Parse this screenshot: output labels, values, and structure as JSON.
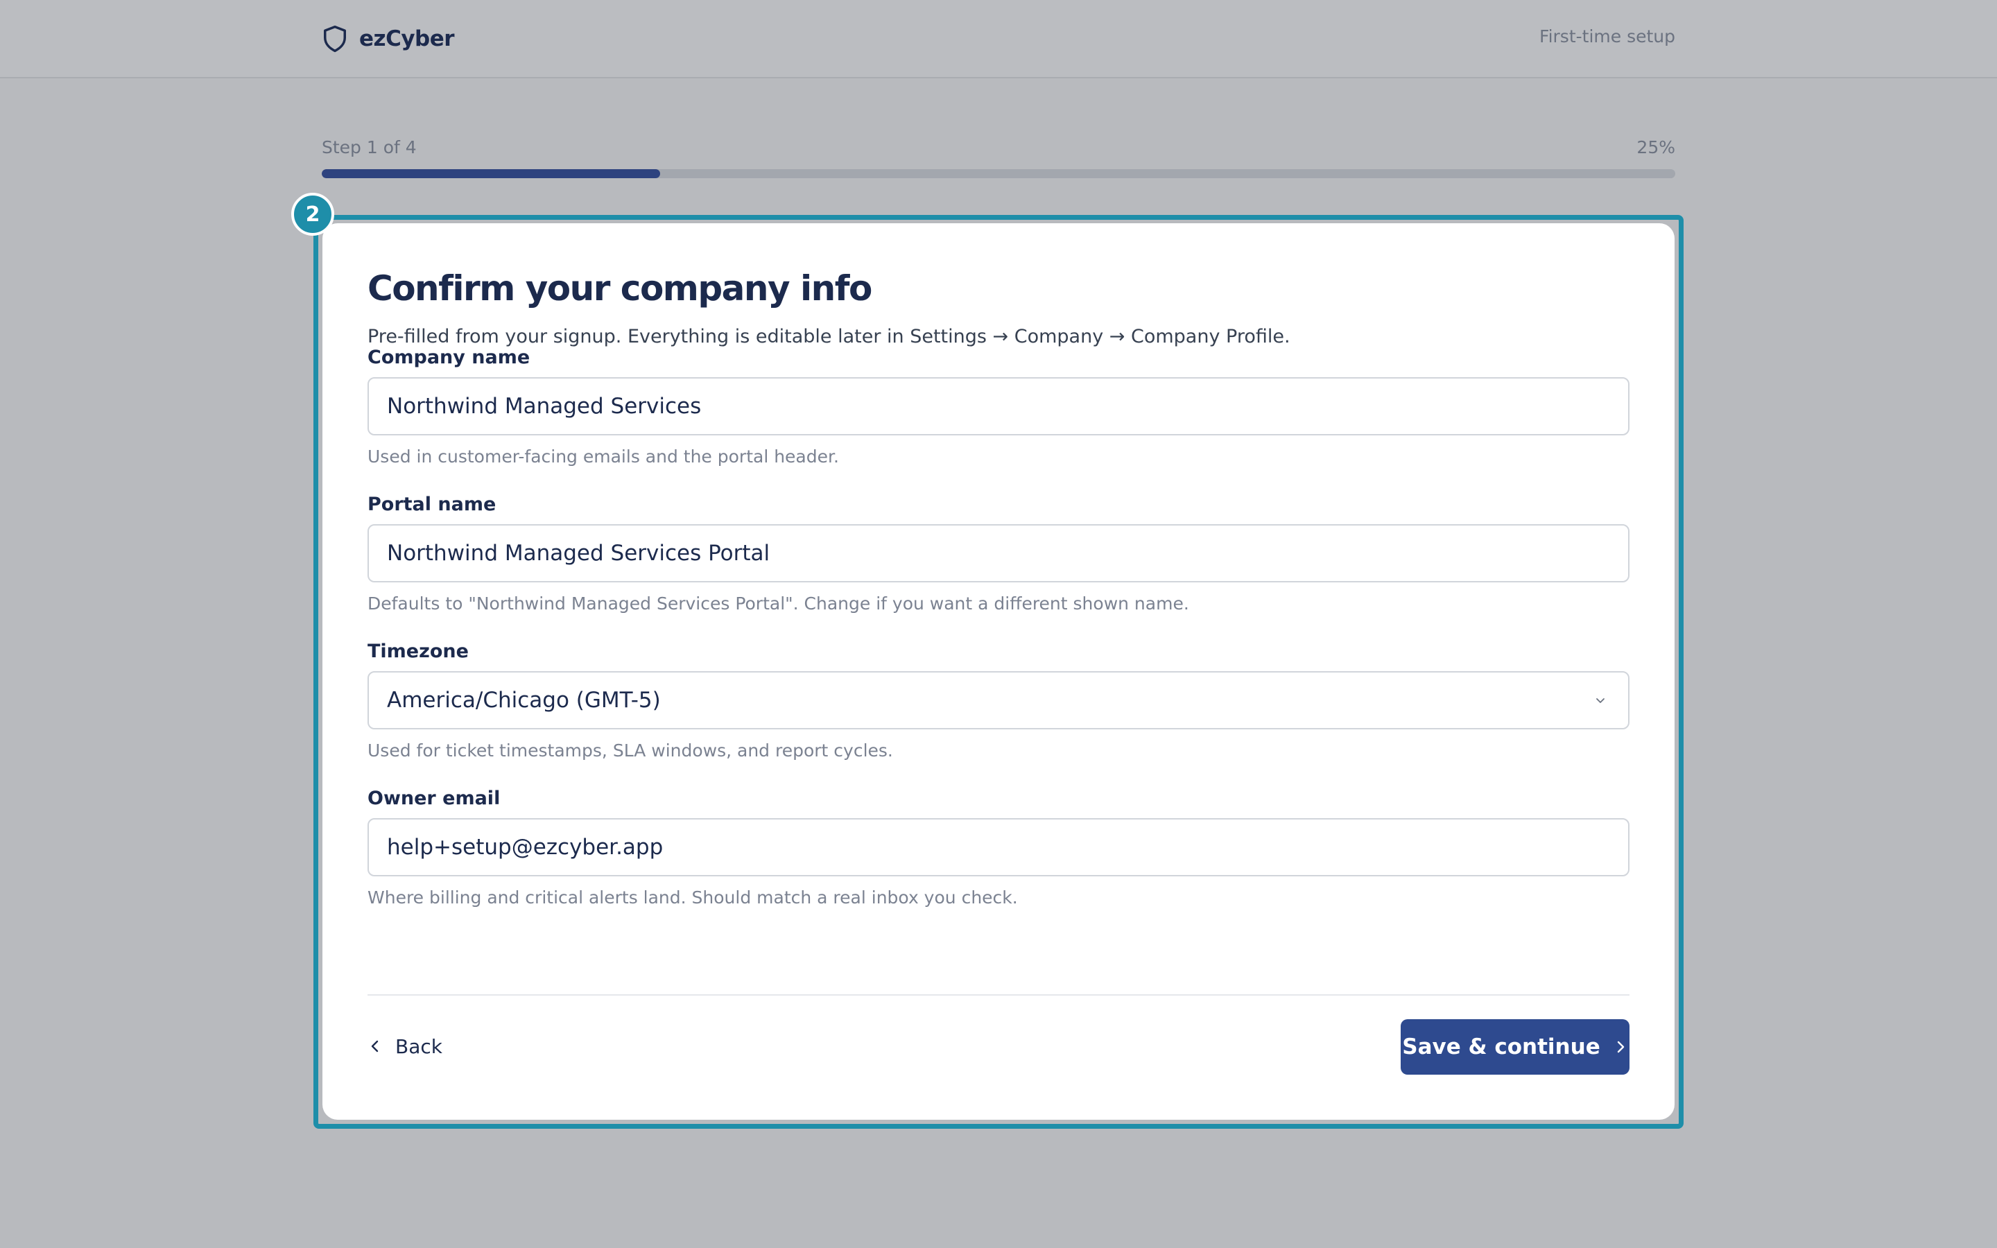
{
  "header": {
    "brand_icon": "shield-icon",
    "brand_name": "ezCyber",
    "setup_label": "First-time setup"
  },
  "progress": {
    "step_label": "Step 1 of 4",
    "percent_label": "25%",
    "percent_value": 0.25
  },
  "highlight_badge": "2",
  "card": {
    "title": "Confirm your company info",
    "subtitle": "Pre-filled from your signup. Everything is editable later in Settings → Company → Company Profile.",
    "fields": [
      {
        "label": "Company name",
        "value": "Northwind Managed Services",
        "hint": "Used in customer-facing emails and the portal header."
      },
      {
        "label": "Portal name",
        "value": "Northwind Managed Services Portal",
        "hint": "Defaults to \"Northwind Managed Services Portal\". Change if you want a different shown name."
      },
      {
        "label": "Timezone",
        "value": "America/Chicago (GMT-5)",
        "hint": "Used for ticket timestamps, SLA windows, and report cycles.",
        "icon": "chevron-down-icon"
      },
      {
        "label": "Owner email",
        "value": "help+setup@ezcyber.app",
        "hint": "Where billing and critical alerts land. Should match a real inbox you check."
      }
    ],
    "back_label": "Back",
    "save_label": "Save & continue"
  },
  "colors": {
    "accent": "#2e4a8f",
    "highlight": "#1e8ea9",
    "text": "#1c2a4d"
  }
}
